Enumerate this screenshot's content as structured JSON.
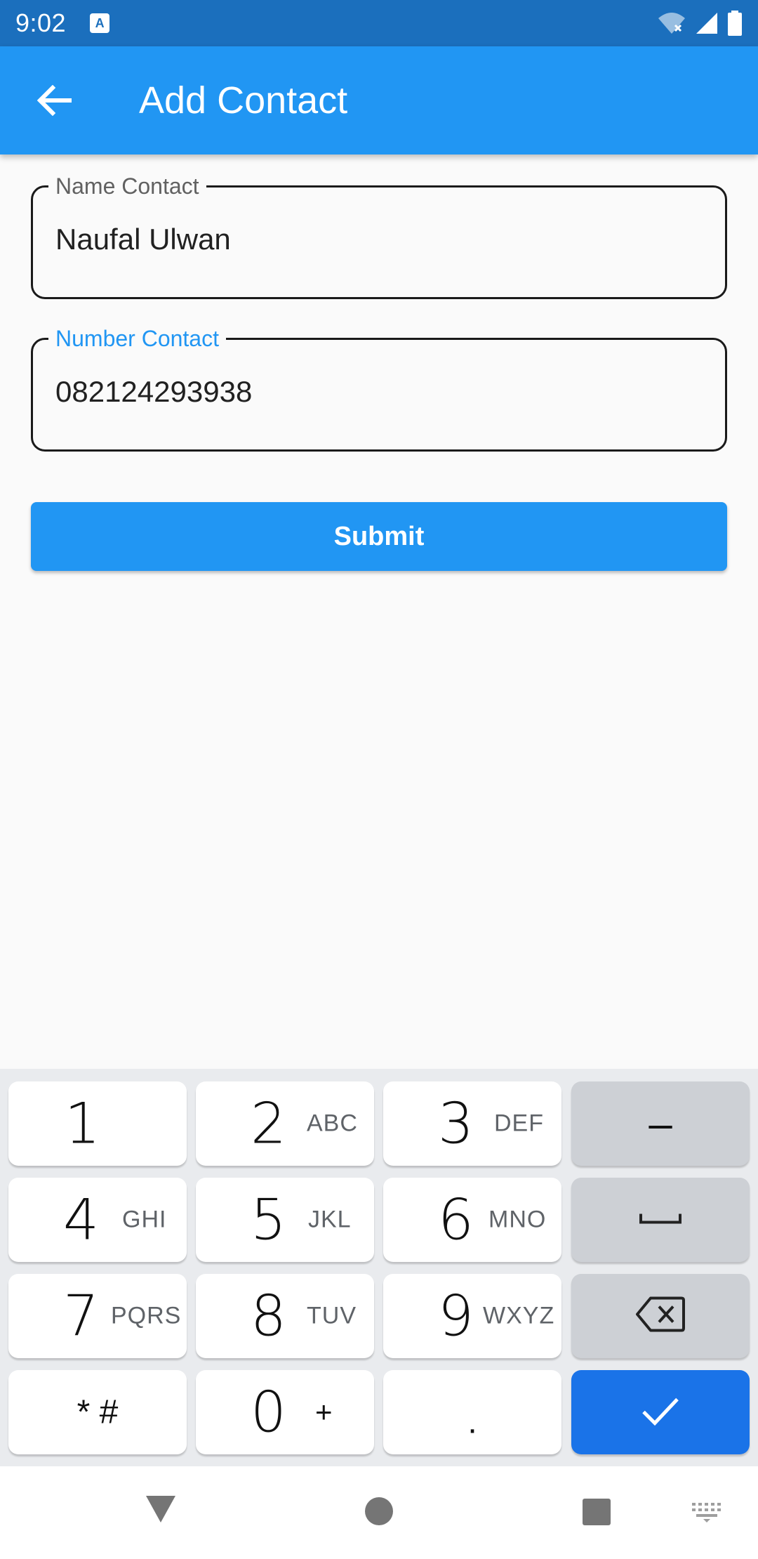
{
  "status_bar": {
    "time": "9:02",
    "notification_icon": "a-letter-icon",
    "icons": [
      "wifi-off-icon",
      "signal-icon",
      "battery-icon"
    ]
  },
  "app_bar": {
    "title": "Add Contact",
    "back_icon": "arrow-back-icon",
    "color": "#2196f3"
  },
  "form": {
    "name_field": {
      "label": "Name Contact",
      "value": "Naufal Ulwan"
    },
    "number_field": {
      "label": "Number Contact",
      "value": "082124293938"
    },
    "submit_label": "Submit"
  },
  "keyboard": {
    "keys": [
      {
        "digit": "1",
        "letters": ""
      },
      {
        "digit": "2",
        "letters": "ABC"
      },
      {
        "digit": "3",
        "letters": "DEF"
      },
      {
        "digit": "4",
        "letters": "GHI"
      },
      {
        "digit": "5",
        "letters": "JKL"
      },
      {
        "digit": "6",
        "letters": "MNO"
      },
      {
        "digit": "7",
        "letters": "PQRS"
      },
      {
        "digit": "8",
        "letters": "TUV"
      },
      {
        "digit": "9",
        "letters": "WXYZ"
      },
      {
        "digit": "0",
        "letters": "+"
      }
    ],
    "star_hash": "* #",
    "period": ".",
    "minus": "–",
    "space_icon": "space-bar-icon",
    "backspace_icon": "backspace-icon",
    "done_icon": "check-icon",
    "accent": "#1a73e8"
  },
  "nav_bar": {
    "icons": [
      "back-triangle-icon",
      "home-circle-icon",
      "recents-square-icon",
      "keyboard-switch-icon"
    ]
  }
}
